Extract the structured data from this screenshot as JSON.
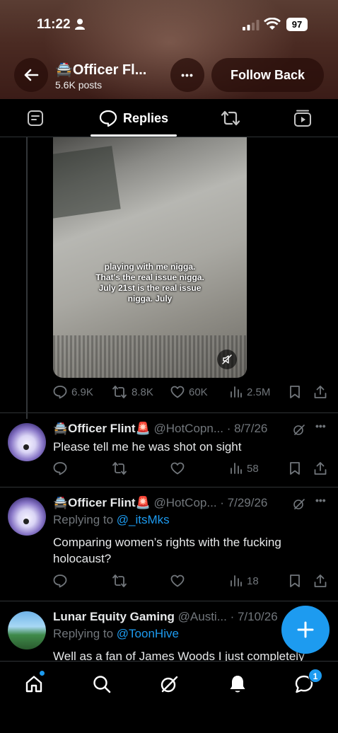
{
  "status_bar": {
    "time": "11:22",
    "battery": "97"
  },
  "profile_header": {
    "title": "🚔Officer Fl...",
    "posts_count": "5.6K posts",
    "follow_back_label": "Follow Back",
    "more_label": "•••"
  },
  "tabs": [
    {
      "label": "",
      "icon": "posts-icon"
    },
    {
      "label": "Replies",
      "icon": "reply-bubble-icon",
      "active": true
    },
    {
      "label": "",
      "icon": "retweet-icon"
    },
    {
      "label": "",
      "icon": "video-icon"
    }
  ],
  "video_post": {
    "caption": "playing with me nigga.\nThat's the real issue nigga.\nJuly 21st is the real issue\nnigga. July",
    "stats": {
      "replies": "6.9K",
      "reposts": "8.8K",
      "likes": "60K",
      "views": "2.5M"
    }
  },
  "posts": [
    {
      "name": "🚔Officer Flint🚨",
      "handle": "@HotCopn... · 8/7/26",
      "text": "Please tell me he was shot on sight",
      "views": "58"
    },
    {
      "name": "🚔Officer Flint🚨",
      "handle": "@HotCop... · 7/29/26",
      "replying_prefix": "Replying to",
      "replying_to": "@_itsMks",
      "text": "Comparing women’s rights with the fucking holocaust?",
      "views": "18"
    },
    {
      "name": "Lunar Equity Gaming",
      "handle": "@Austi... · 7/10/26",
      "replying_prefix": "Replying to",
      "replying_to": "@ToonHive",
      "text": "Well as a fan of James Woods I just completely"
    }
  ],
  "bottom_nav": {
    "messages_badge": "1"
  },
  "colors": {
    "accent": "#1d9bf0",
    "muted": "#71767b",
    "background": "#000000"
  }
}
